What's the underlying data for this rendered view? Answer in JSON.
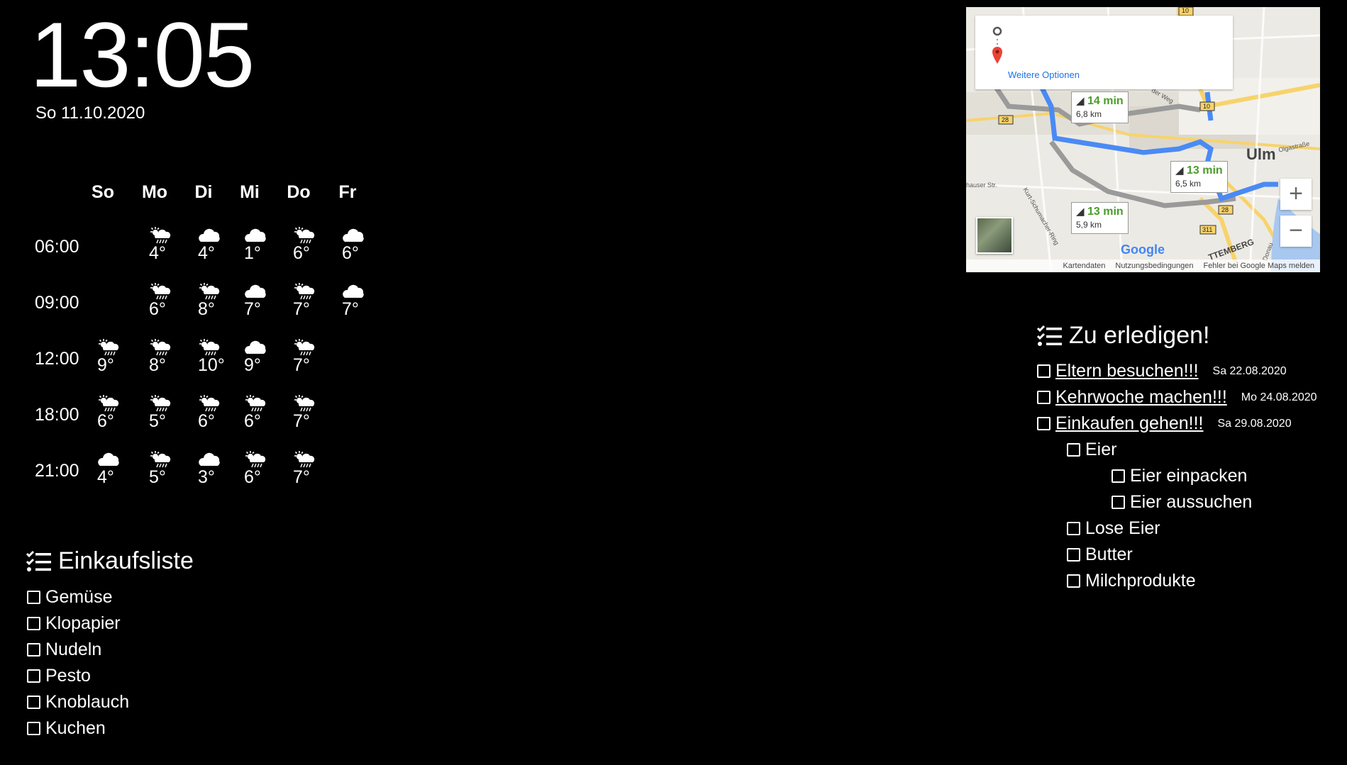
{
  "clock": {
    "time": "13:05",
    "date": "So 11.10.2020"
  },
  "weather": {
    "days": [
      "So",
      "Mo",
      "Di",
      "Mi",
      "Do",
      "Fr"
    ],
    "times": [
      "06:00",
      "09:00",
      "12:00",
      "18:00",
      "21:00"
    ],
    "rows": [
      [
        null,
        {
          "icon": "sun-rain-icon",
          "temp": "4°"
        },
        {
          "icon": "cloud-icon",
          "temp": "4°"
        },
        {
          "icon": "cloud-icon",
          "temp": "1°"
        },
        {
          "icon": "sun-rain-icon",
          "temp": "6°"
        },
        {
          "icon": "cloud-icon",
          "temp": "6°"
        }
      ],
      [
        null,
        {
          "icon": "sun-rain-icon",
          "temp": "6°"
        },
        {
          "icon": "sun-rain-icon",
          "temp": "8°"
        },
        {
          "icon": "cloud-icon",
          "temp": "7°"
        },
        {
          "icon": "sun-rain-icon",
          "temp": "7°"
        },
        {
          "icon": "cloud-icon",
          "temp": "7°"
        }
      ],
      [
        {
          "icon": "sun-rain-icon",
          "temp": "9°"
        },
        {
          "icon": "sun-rain-icon",
          "temp": "8°"
        },
        {
          "icon": "sun-rain-icon",
          "temp": "10°"
        },
        {
          "icon": "cloud-icon",
          "temp": "9°"
        },
        {
          "icon": "sun-rain-icon",
          "temp": "7°"
        },
        null
      ],
      [
        {
          "icon": "sun-rain-icon",
          "temp": "6°"
        },
        {
          "icon": "sun-rain-icon",
          "temp": "5°"
        },
        {
          "icon": "sun-rain-icon",
          "temp": "6°"
        },
        {
          "icon": "sun-rain-icon",
          "temp": "6°"
        },
        {
          "icon": "sun-rain-icon",
          "temp": "7°"
        },
        null
      ],
      [
        {
          "icon": "cloud-icon",
          "temp": "4°"
        },
        {
          "icon": "sun-rain-icon",
          "temp": "5°"
        },
        {
          "icon": "cloud-icon",
          "temp": "3°"
        },
        {
          "icon": "sun-rain-icon",
          "temp": "6°"
        },
        {
          "icon": "sun-rain-icon",
          "temp": "7°"
        },
        null
      ]
    ]
  },
  "shopping": {
    "title": "Einkaufsliste",
    "items": [
      "Gemüse",
      "Klopapier",
      "Nudeln",
      "Pesto",
      "Knoblauch",
      "Kuchen"
    ]
  },
  "todo": {
    "title": "Zu erledigen!",
    "items": [
      {
        "text": "Eltern besuchen!!!",
        "date": "Sa 22.08.2020",
        "level": 0,
        "underline": true
      },
      {
        "text": "Kehrwoche machen!!!",
        "date": "Mo 24.08.2020",
        "level": 0,
        "underline": true
      },
      {
        "text": "Einkaufen gehen!!!",
        "date": "Sa 29.08.2020",
        "level": 0,
        "underline": true
      },
      {
        "text": "Eier",
        "date": "",
        "level": 1,
        "underline": false
      },
      {
        "text": "Eier einpacken",
        "date": "",
        "level": 2,
        "underline": false
      },
      {
        "text": "Eier aussuchen",
        "date": "",
        "level": 2,
        "underline": false
      },
      {
        "text": "Lose Eier",
        "date": "",
        "level": 1,
        "underline": false
      },
      {
        "text": "Butter",
        "date": "",
        "level": 1,
        "underline": false
      },
      {
        "text": "Milchprodukte",
        "date": "",
        "level": 1,
        "underline": false
      }
    ]
  },
  "map": {
    "more_options": "Weitere Optionen",
    "routes": [
      {
        "time": "14 min",
        "distance": "6,8 km"
      },
      {
        "time": "13 min",
        "distance": "6,5 km"
      },
      {
        "time": "13 min",
        "distance": "5,9 km"
      }
    ],
    "city_label": "Ulm",
    "area_label": "TTEMBERG",
    "road_labels": [
      "10",
      "28",
      "10",
      "28",
      "311"
    ],
    "street_labels": [
      "Olgastraße",
      "der Weg",
      "hauser Str.",
      "Kurt-Schumacher-Ring",
      "Donau"
    ],
    "zoom_in": "+",
    "zoom_out": "−",
    "google_logo": "Google",
    "footer": [
      "Kartendaten",
      "Nutzungsbedingungen",
      "Fehler bei Google Maps melden"
    ],
    "colors": {
      "route_primary": "#4a8af4",
      "route_alt": "#a0a0a0",
      "route_time": "#4a9c2a"
    }
  }
}
